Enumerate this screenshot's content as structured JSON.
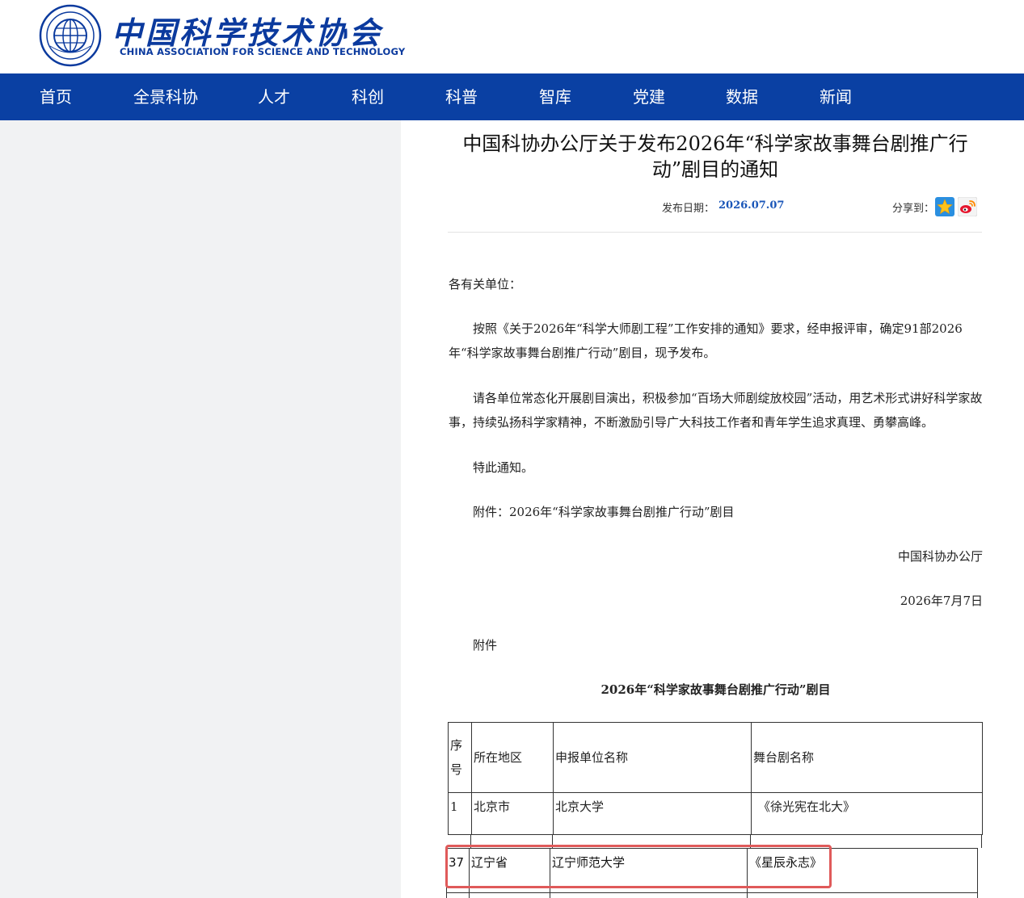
{
  "header": {
    "logo_cn": "中国科学技术协会",
    "logo_en": "CHINA ASSOCIATION FOR SCIENCE AND TECHNOLOGY"
  },
  "nav": {
    "items": [
      {
        "label": "首页"
      },
      {
        "label": "全景科协"
      },
      {
        "label": "人才"
      },
      {
        "label": "科创"
      },
      {
        "label": "科普"
      },
      {
        "label": "智库"
      },
      {
        "label": "党建"
      },
      {
        "label": "数据"
      },
      {
        "label": "新闻"
      }
    ]
  },
  "article": {
    "title": "中国科协办公厅关于发布2026年“科学家故事舞台剧推广行动”剧目的通知",
    "date_label": "发布日期：",
    "date": "2026.07.07",
    "share_label": "分享到：",
    "salutation": "各有关单位：",
    "para1": "按照《关于2026年“科学大师剧工程”工作安排的通知》要求，经申报评审，确定91部2026年“科学家故事舞台剧推广行动”剧目，现予发布。",
    "para2": "请各单位常态化开展剧目演出，积极参加“百场大师剧绽放校园”活动，用艺术形式讲好科学家故事，持续弘扬科学家精神，不断激励引导广大科技工作者和青年学生追求真理、勇攀高峰。",
    "para3": "特此通知。",
    "attachment_line": "附件：2026年“科学家故事舞台剧推广行动”剧目",
    "signer": "中国科协办公厅",
    "sign_date": "2026年7月7日",
    "attachment_heading": "附件",
    "table_title": "2026年“科学家故事舞台剧推广行动”剧目"
  },
  "table": {
    "headers": [
      "序号",
      "所在地区",
      "申报单位名称",
      "舞台剧名称"
    ],
    "rows": [
      [
        "1",
        "北京市",
        "北京大学",
        "《徐光宪在北大》"
      ],
      [
        "37",
        "辽宁省",
        "辽宁师范大学",
        "《星辰永志》"
      ]
    ]
  },
  "colors": {
    "brand_blue": "#0a40a3",
    "date_blue": "#1a56b8",
    "highlight_red": "#e05a5a"
  },
  "icons": {
    "seal": "association-seal-icon",
    "share1": "qzone-star-icon",
    "share2": "weibo-icon"
  }
}
